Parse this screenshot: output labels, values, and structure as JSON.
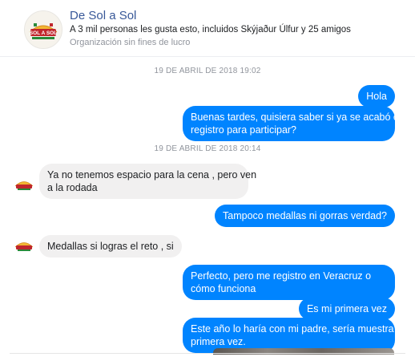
{
  "header": {
    "page_name": "De Sol a Sol",
    "likes_text": "A 3 mil personas les gusta esto, incluidos Skýjaður Úlfur y 25 amigos",
    "category": "Organización sin fines de lucro",
    "avatar_icon": "de-sol-a-sol-logo",
    "avatar_text": "SOL A SOL"
  },
  "conversation": {
    "timestamps": [
      "19 DE ABRIL DE 2018 19:02",
      "19 DE ABRIL DE 2018 20:14"
    ],
    "messages": [
      {
        "from": "me",
        "lines": [
          "Hola"
        ]
      },
      {
        "from": "me",
        "lines": [
          "Buenas tardes, quisiera saber si ya se acabó el",
          "registro para participar?"
        ]
      },
      {
        "from": "page",
        "lines": [
          "Ya no tenemos espacio para la cena , pero ven",
          "a la rodada"
        ]
      },
      {
        "from": "me",
        "lines": [
          "Tampoco medallas ni gorras verdad?"
        ]
      },
      {
        "from": "page",
        "lines": [
          "Medallas si logras el reto , si"
        ]
      },
      {
        "from": "me",
        "lines": [
          "Perfecto, pero me registro en Veracruz o",
          "cómo funciona"
        ]
      },
      {
        "from": "me",
        "lines": [
          "Es mi primera vez"
        ]
      },
      {
        "from": "me",
        "lines": [
          "Este año lo haría con mi padre, sería muestra",
          "primera vez."
        ]
      }
    ]
  },
  "colors": {
    "outgoing_bubble": "#0084ff",
    "incoming_bubble": "#f1f0f0",
    "page_name": "#385898"
  }
}
